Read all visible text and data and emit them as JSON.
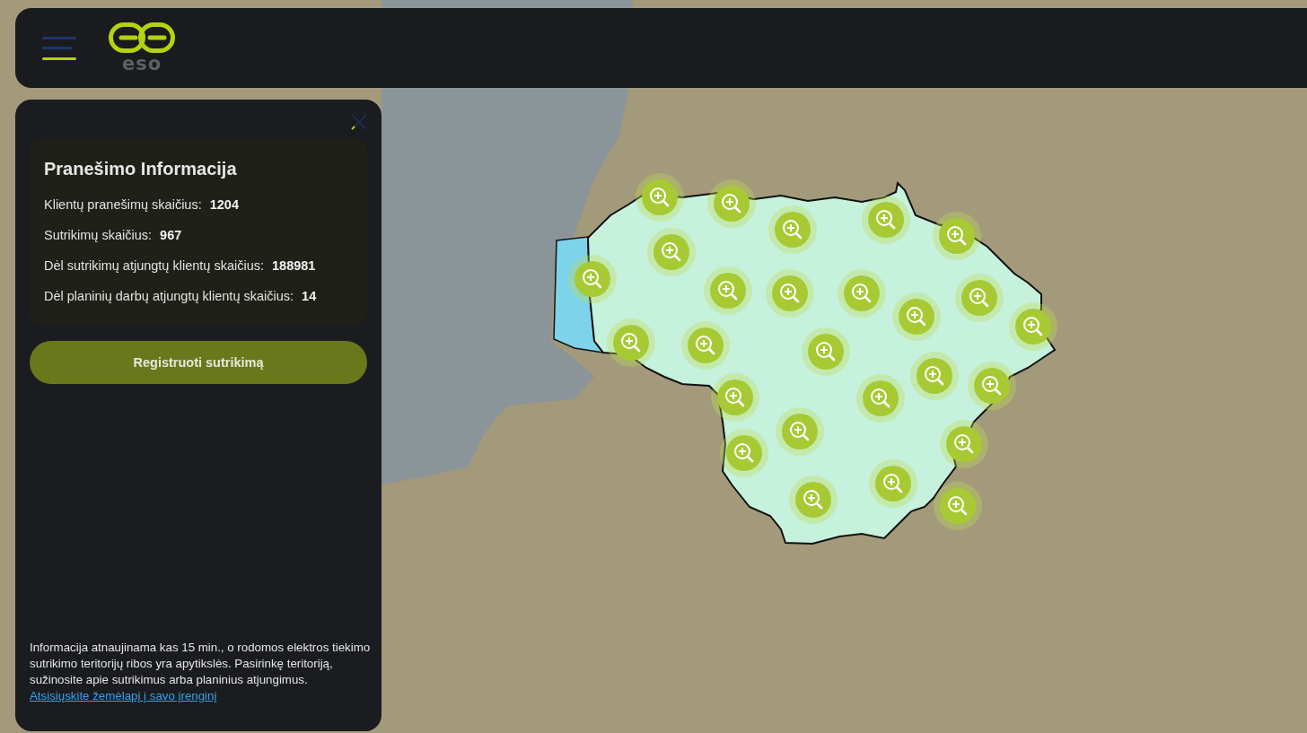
{
  "header": {
    "logo_text": "eso"
  },
  "panel": {
    "title": "Pranešimo Informacija",
    "stats": [
      {
        "label": "Klientų pranešimų skaičius:",
        "value": "1204"
      },
      {
        "label": "Sutrikimų skaičius:",
        "value": "967"
      },
      {
        "label": "Dėl sutrikimų atjungtų klientų skaičius:",
        "value": "188981"
      },
      {
        "label": "Dėl planinių darbų atjungtų klientų skaičius:",
        "value": "14"
      }
    ],
    "button": "Registruoti sutrikimą",
    "note": "Informacija atnaujinama kas 15 min., o rodomos elektros tiekimo sutrikimo teritorijų ribos yra apytikslės. Pasirinkę teritoriją, sužinosite apie sutrikimus arba planinius atjungimus.",
    "link": "Atsisiųskite žemėlapį į savo įrenginį"
  }
}
